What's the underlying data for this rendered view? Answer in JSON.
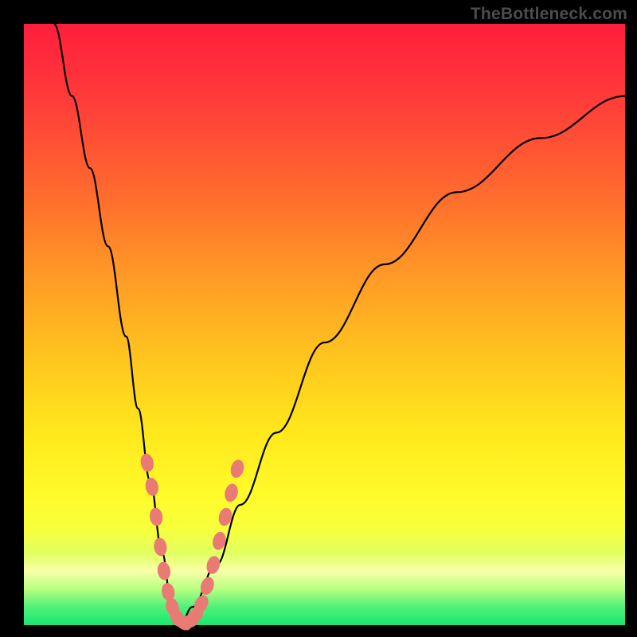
{
  "watermark": {
    "text": "TheBottleneck.com"
  },
  "chart_data": {
    "type": "line",
    "title": "",
    "xlabel": "",
    "ylabel": "",
    "xlim": [
      0,
      100
    ],
    "ylim": [
      0,
      100
    ],
    "grid": false,
    "legend": false,
    "background_gradient": {
      "direction": "vertical",
      "stops": [
        {
          "pos": 0,
          "color": "#FF1E3C"
        },
        {
          "pos": 28,
          "color": "#FF6A2E"
        },
        {
          "pos": 56,
          "color": "#FFC61E"
        },
        {
          "pos": 78,
          "color": "#FFFA2A"
        },
        {
          "pos": 94,
          "color": "#B8FF80"
        },
        {
          "pos": 100,
          "color": "#18E870"
        }
      ]
    },
    "series": [
      {
        "name": "bottleneck-curve",
        "x": [
          5,
          8,
          11,
          14,
          17,
          19,
          21,
          23,
          24.5,
          26,
          28,
          32,
          36,
          42,
          50,
          60,
          72,
          86,
          100
        ],
        "values": [
          100,
          88,
          76,
          63,
          48,
          36,
          24,
          12,
          4,
          0,
          3,
          10,
          20,
          32,
          47,
          60,
          72,
          81,
          88
        ]
      }
    ],
    "markers": {
      "name": "highlighted-range-beads",
      "color": "#E97A74",
      "points": [
        {
          "x": 20.5,
          "y": 27
        },
        {
          "x": 21.3,
          "y": 23
        },
        {
          "x": 22.0,
          "y": 18
        },
        {
          "x": 22.7,
          "y": 13
        },
        {
          "x": 23.3,
          "y": 9
        },
        {
          "x": 24.0,
          "y": 5.5
        },
        {
          "x": 24.7,
          "y": 3
        },
        {
          "x": 25.5,
          "y": 1.2
        },
        {
          "x": 26.5,
          "y": 0.4
        },
        {
          "x": 27.5,
          "y": 0.6
        },
        {
          "x": 28.5,
          "y": 1.6
        },
        {
          "x": 29.5,
          "y": 3.5
        },
        {
          "x": 30.5,
          "y": 6.5
        },
        {
          "x": 31.5,
          "y": 10
        },
        {
          "x": 32.5,
          "y": 14
        },
        {
          "x": 33.5,
          "y": 18
        },
        {
          "x": 34.5,
          "y": 22
        },
        {
          "x": 35.5,
          "y": 26
        }
      ]
    }
  }
}
